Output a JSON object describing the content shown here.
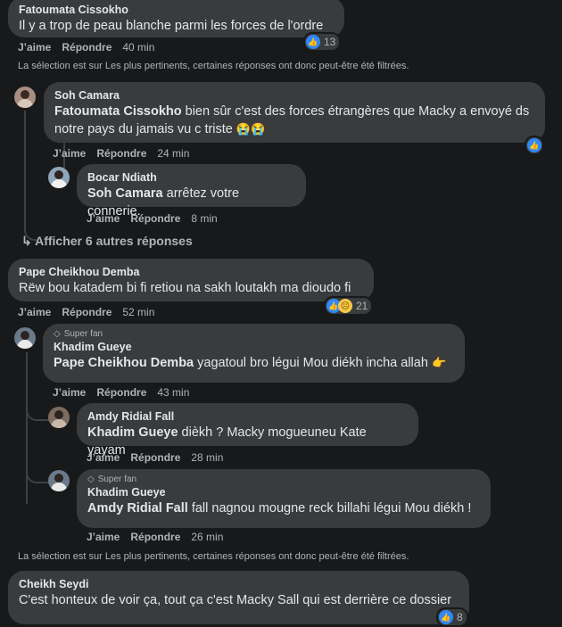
{
  "actions": {
    "like": "J’aime",
    "reply": "Répondre"
  },
  "notice": "La sélection est sur Les plus pertinents, certaines réponses ont donc peut-être été filtrées.",
  "comments": [
    {
      "author": "Fatoumata Cissokho",
      "text": "Il y a trop de peau blanche parmi les forces de l'ordre",
      "time": "40 min",
      "reactions": "13"
    },
    {
      "author": "Soh Camara",
      "mention": "Fatoumata Cissokho",
      "text": " bien sûr c'est des forces étrangères que Macky a envoyé ds notre pays du jamais vu c triste ",
      "emoji": "😭😭",
      "time": "24 min"
    },
    {
      "author": "Bocar Ndiath",
      "mention": "Soh Camara",
      "text": " arrêtez votre connerie.",
      "time": "8 min"
    },
    {
      "author": "Pape Cheikhou Demba",
      "text": "Rëw bou katadem bi fi retiou na sakh loutakh ma dioudo fi",
      "time": "52 min",
      "reactions": "21"
    },
    {
      "badge": "Super fan",
      "author": "Khadim Gueye",
      "mention": "Pape Cheikhou Demba",
      "text": " yagatoul bro légui Mou diékh incha allah ",
      "emoji": "👉",
      "time": "43 min"
    },
    {
      "author": "Amdy Ridial Fall",
      "mention": "Khadim Gueye",
      "text": " dièkh ? Macky mogueuneu Kate yayam",
      "time": "28 min"
    },
    {
      "badge": "Super fan",
      "author": "Khadim Gueye",
      "mention": "Amdy Ridial Fall",
      "text": " fall nagnou mougne reck billahi légui Mou diékh !",
      "time": "26 min"
    },
    {
      "author": "Cheikh Seydi",
      "text": "C'est honteux de voir ça, tout ça c'est Macky Sall qui est derrière ce dossier",
      "reactions": "8"
    }
  ],
  "more_replies": "Afficher 6 autres réponses"
}
